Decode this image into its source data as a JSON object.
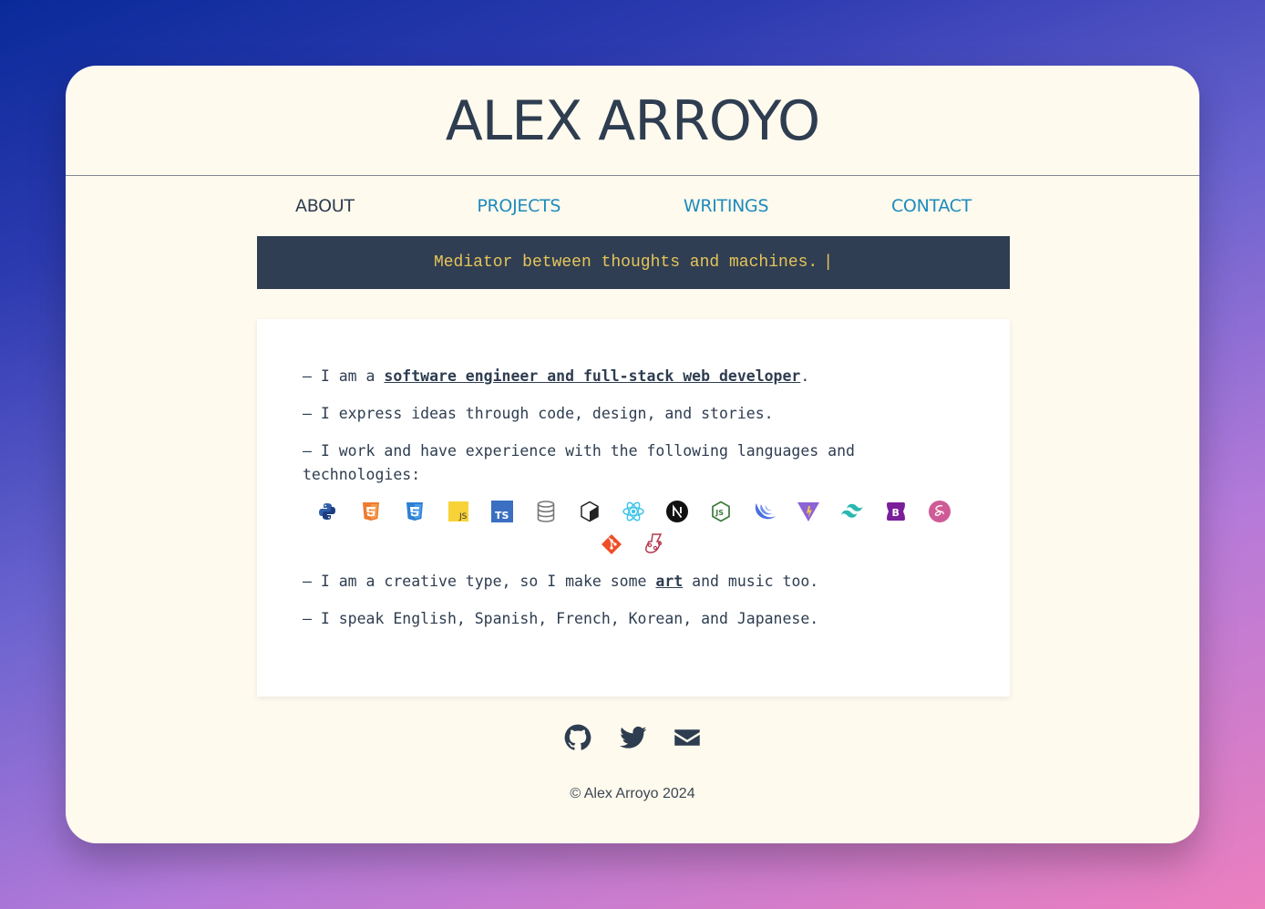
{
  "header": {
    "title": "ALEX ARROYO"
  },
  "nav": {
    "items": [
      {
        "label": "ABOUT",
        "active": true
      },
      {
        "label": "PROJECTS",
        "active": false
      },
      {
        "label": "WRITINGS",
        "active": false
      },
      {
        "label": "CONTACT",
        "active": false
      }
    ]
  },
  "tagline": {
    "text": "Mediator between thoughts and machines.",
    "cursor": "|"
  },
  "about": {
    "line1_prefix": "– I am a ",
    "line1_link": "software engineer and full-stack web developer",
    "line1_suffix": ".",
    "line2": "– I express ideas through code, design, and stories.",
    "line3": "– I work and have experience with the following languages and technologies:",
    "line4_prefix": "– I am a creative type, so I make some ",
    "line4_link": "art",
    "line4_suffix": " and music too.",
    "line5": "– I speak English, Spanish, French, Korean, and Japanese."
  },
  "tech_icons": [
    "python-icon",
    "html5-icon",
    "css3-icon",
    "javascript-icon",
    "typescript-icon",
    "database-icon",
    "bun-icon",
    "react-icon",
    "nextjs-icon",
    "nodejs-icon",
    "jquery-icon",
    "vite-icon",
    "tailwind-icon",
    "bootstrap-icon",
    "sass-icon",
    "git-icon",
    "jest-icon"
  ],
  "footer": {
    "icons": [
      "github-icon",
      "twitter-icon",
      "email-icon"
    ],
    "copyright": "© Alex Arroyo 2024"
  },
  "colors": {
    "page_bg": "#fffaee",
    "accent": "#1e8bbd",
    "dark": "#2e3d50",
    "tagline_text": "#e6c45a"
  }
}
